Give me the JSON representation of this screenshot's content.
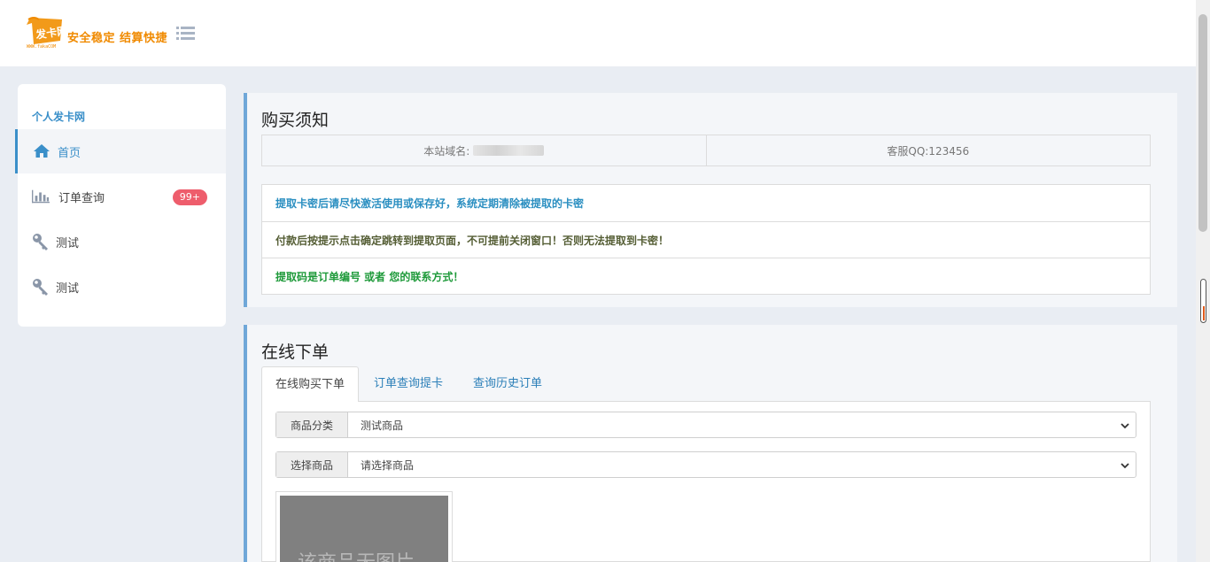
{
  "header": {
    "logo_text": "发卡网",
    "logo_slogan": "安全稳定 结算快捷",
    "logo_url": "WWW.fakaCOM"
  },
  "sidebar": {
    "title": "个人发卡网",
    "items": [
      {
        "label": "首页",
        "icon": "home-icon",
        "active": true
      },
      {
        "label": "订单查询",
        "icon": "bar-chart-icon",
        "badge": "99+"
      },
      {
        "label": "测试",
        "icon": "key-icon"
      },
      {
        "label": "测试",
        "icon": "key-icon"
      }
    ]
  },
  "notice_panel": {
    "title": "购买须知",
    "domain_label": "本站域名:",
    "qq_label": "客服QQ:123456",
    "notices": [
      "提取卡密后请尽快激活使用或保存好，系统定期清除被提取的卡密",
      "付款后按提示点击确定跳转到提取页面，不可提前关闭窗口！否则无法提取到卡密！",
      "提取码是订单编号 或者 您的联系方式！"
    ]
  },
  "order_panel": {
    "title": "在线下单",
    "tabs": [
      "在线购买下单",
      "订单查询提卡",
      "查询历史订单"
    ],
    "category_label": "商品分类",
    "category_value": "测试商品",
    "product_label": "选择商品",
    "product_value": "请选择商品",
    "no_image_text": "该商品无图片"
  },
  "colors": {
    "accent": "#3a8fc9",
    "badge": "#ee5d6c",
    "logo_orange": "#f08a00"
  }
}
